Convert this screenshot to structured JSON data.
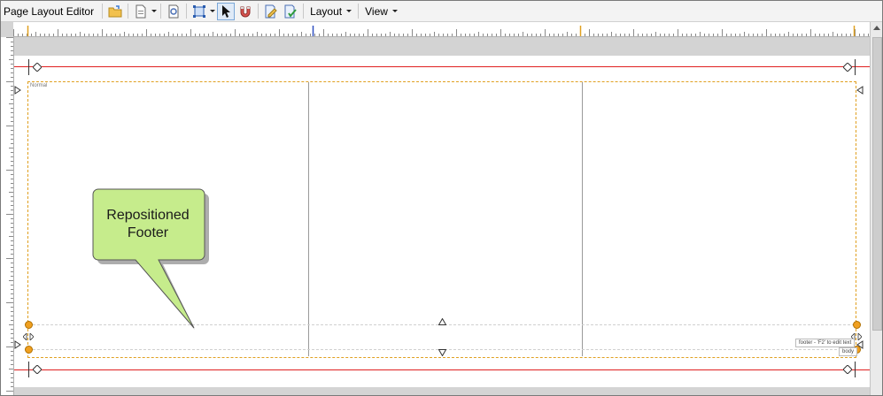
{
  "toolbar": {
    "title": "Page Layout Editor",
    "layout_menu": "Layout",
    "view_menu": "View"
  },
  "page": {
    "template_label": "Normal",
    "footer_tip": "footer - 'F2' to edit text",
    "body_tip": "body"
  },
  "callout": {
    "line1": "Repositioned",
    "line2": "Footer",
    "fill_color": "#c6ec8c",
    "border_color": "#555555"
  },
  "icons": [
    "open-folder-icon",
    "page-icon",
    "preview-icon",
    "frame-select-icon",
    "pointer-icon",
    "magnet-icon",
    "edit-page-icon",
    "apply-page-icon"
  ]
}
